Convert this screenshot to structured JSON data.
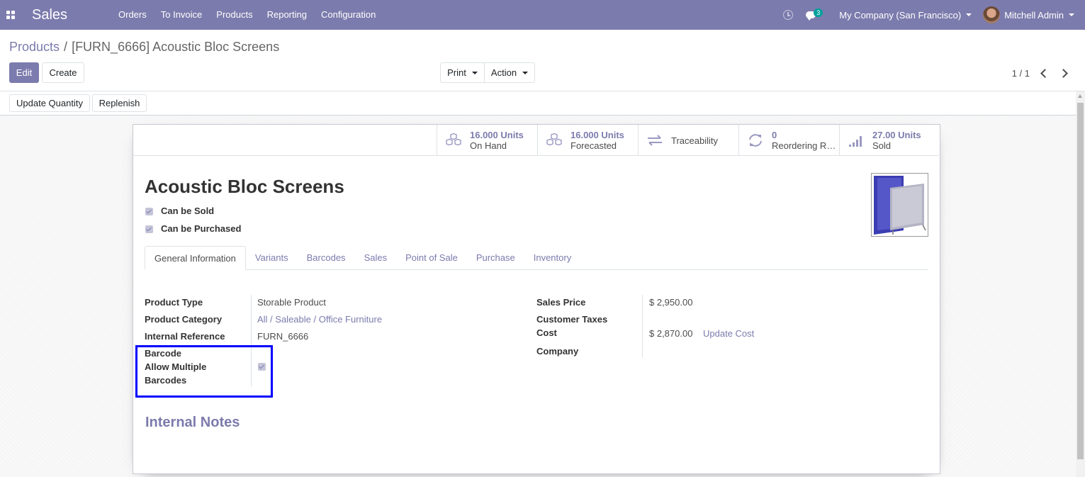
{
  "navbar": {
    "app_name": "Sales",
    "menu": [
      "Orders",
      "To Invoice",
      "Products",
      "Reporting",
      "Configuration"
    ],
    "chat_count": "3",
    "company": "My Company (San Francisco)",
    "user": "Mitchell Admin",
    "color": "#7c7bad"
  },
  "breadcrumb": {
    "parent": "Products",
    "separator": "/",
    "current": "[FURN_6666] Acoustic Bloc Screens"
  },
  "buttons": {
    "edit": "Edit",
    "create": "Create",
    "print": "Print",
    "action": "Action",
    "update_quantity": "Update Quantity",
    "replenish": "Replenish"
  },
  "pager": {
    "value": "1 / 1"
  },
  "stats": [
    {
      "value": "16.000 Units",
      "label": "On Hand",
      "icon": "cubes-icon"
    },
    {
      "value": "16.000 Units",
      "label": "Forecasted",
      "icon": "cubes-icon"
    },
    {
      "label": "Traceability",
      "icon": "exchange-icon"
    },
    {
      "value": "0",
      "label": "Reordering Rules",
      "icon": "refresh-icon"
    },
    {
      "value": "27.00 Units",
      "label": "Sold",
      "icon": "signal-icon"
    }
  ],
  "product": {
    "name": "Acoustic Bloc Screens",
    "can_be_sold": "Can be Sold",
    "can_be_purchased": "Can be Purchased"
  },
  "tabs": [
    "General Information",
    "Variants",
    "Barcodes",
    "Sales",
    "Point of Sale",
    "Purchase",
    "Inventory"
  ],
  "general": {
    "left": {
      "product_type_label": "Product Type",
      "product_type": "Storable Product",
      "product_category_label": "Product Category",
      "product_category": "All / Saleable / Office Furniture",
      "internal_reference_label": "Internal Reference",
      "internal_reference": "FURN_6666",
      "barcode_label": "Barcode",
      "allow_multiple_label_1": "Allow Multiple",
      "allow_multiple_label_2": "Barcodes"
    },
    "right": {
      "sales_price_label": "Sales Price",
      "sales_price": "$ 2,950.00",
      "customer_taxes_label": "Customer Taxes",
      "cost_label": "Cost",
      "cost": "$ 2,870.00",
      "update_cost": "Update Cost",
      "company_label": "Company"
    }
  },
  "internal_notes": "Internal Notes"
}
